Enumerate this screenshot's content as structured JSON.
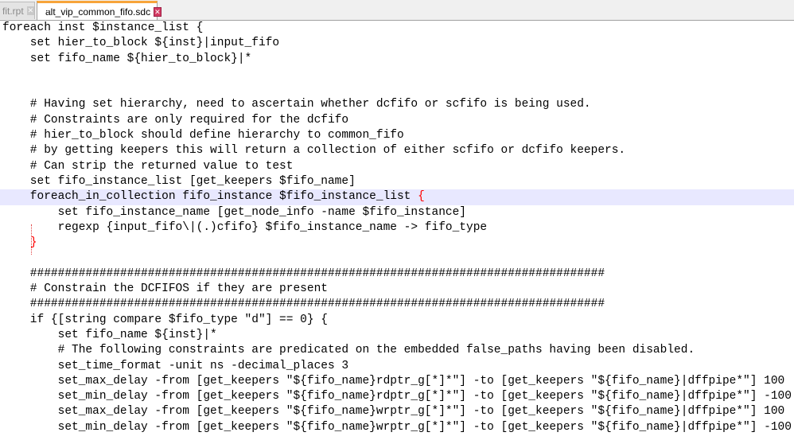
{
  "tabs": [
    {
      "label": "fit.rpt",
      "active": false
    },
    {
      "label": "alt_vip_common_fifo.sdc",
      "active": true
    }
  ],
  "colors": {
    "accent": "#f7a43a",
    "highlight": "#e8e8ff",
    "brace": "#ff0000"
  },
  "lines": [
    "foreach inst $instance_list {",
    "    set hier_to_block ${inst}|input_fifo",
    "    set fifo_name ${hier_to_block}|*",
    "",
    "",
    "    # Having set hierarchy, need to ascertain whether dcfifo or scfifo is being used.",
    "    # Constraints are only required for the dcfifo",
    "    # hier_to_block should define hierarchy to common_fifo",
    "    # by getting keepers this will return a collection of either scfifo or dcfifo keepers.",
    "    # Can strip the returned value to test",
    "    set fifo_instance_list [get_keepers $fifo_name]",
    "    foreach_in_collection fifo_instance $fifo_instance_list ",
    "        set fifo_instance_name [get_node_info -name $fifo_instance]",
    "        regexp {input_fifo\\|(.)cfifo} $fifo_instance_name -> fifo_type",
    "    ",
    "",
    "    ###################################################################################",
    "    # Constrain the DCFIFOS if they are present",
    "    ###################################################################################",
    "    if {[string compare $fifo_type \"d\"] == 0} {",
    "        set fifo_name ${inst}|*",
    "        # The following constraints are predicated on the embedded false_paths having been disabled.",
    "        set_time_format -unit ns -decimal_places 3",
    "        set_max_delay -from [get_keepers \"${fifo_name}rdptr_g[*]*\"] -to [get_keepers \"${fifo_name}|dffpipe*\"] 100",
    "        set_min_delay -from [get_keepers \"${fifo_name}rdptr_g[*]*\"] -to [get_keepers \"${fifo_name}|dffpipe*\"] -100",
    "        set_max_delay -from [get_keepers \"${fifo_name}wrptr_g[*]*\"] -to [get_keepers \"${fifo_name}|dffpipe*\"] 100",
    "        set_min_delay -from [get_keepers \"${fifo_name}wrptr_g[*]*\"] -to [get_keepers \"${fifo_name}|dffpipe*\"] -100"
  ],
  "braces": {
    "open": "{",
    "close": "}"
  }
}
